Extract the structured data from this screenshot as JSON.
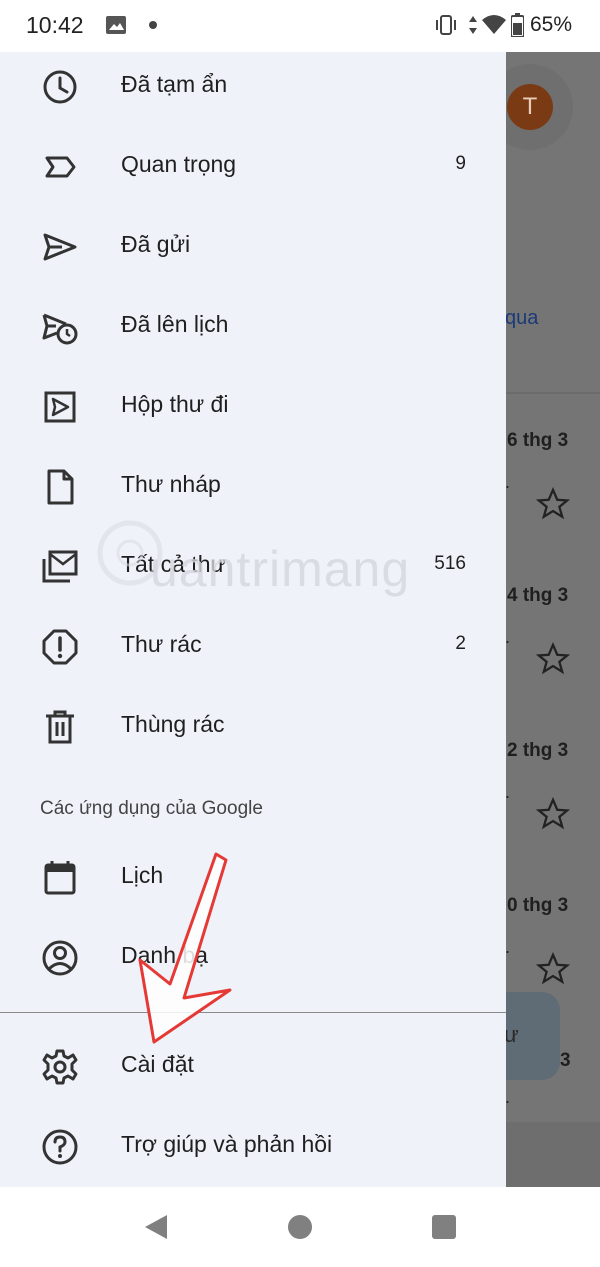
{
  "status_bar": {
    "time": "10:42",
    "battery": "65%",
    "icons": [
      "image-icon",
      "dot-icon",
      "vibrate-icon",
      "data-icon",
      "wifi-icon",
      "battery-icon"
    ]
  },
  "drawer": {
    "items": [
      {
        "label": "Đã tạm ẩn",
        "count": "",
        "icon": "clock-icon"
      },
      {
        "label": "Quan trọng",
        "count": "9",
        "icon": "label-important-icon"
      },
      {
        "label": "Đã gửi",
        "count": "",
        "icon": "send-icon"
      },
      {
        "label": "Đã lên lịch",
        "count": "",
        "icon": "scheduled-send-icon"
      },
      {
        "label": "Hộp thư đi",
        "count": "",
        "icon": "outbox-icon"
      },
      {
        "label": "Thư nháp",
        "count": "",
        "icon": "draft-icon"
      },
      {
        "label": "Tất cả thư",
        "count": "516",
        "icon": "all-mail-icon"
      },
      {
        "label": "Thư rác",
        "count": "2",
        "icon": "spam-icon"
      },
      {
        "label": "Thùng rác",
        "count": "",
        "icon": "trash-icon"
      }
    ],
    "google_apps_label": "Các ứng dụng của Google",
    "apps": [
      {
        "label": "Lịch",
        "icon": "calendar-icon"
      },
      {
        "label": "Danh bạ",
        "icon": "contacts-icon"
      }
    ],
    "footer": [
      {
        "label": "Cài đặt",
        "icon": "settings-icon"
      },
      {
        "label": "Trợ giúp và phản hồi",
        "icon": "help-icon"
      }
    ]
  },
  "background": {
    "avatar_letter": "T",
    "link_fragment": "qua",
    "dates": [
      "6 thg 3",
      "4 thg 3",
      "2 thg 3",
      "0 thg 3",
      "3"
    ],
    "fab_fragment": "ư"
  },
  "watermark": "uantrimang",
  "colors": {
    "drawer_bg": "#eff2f9",
    "scrim": "#757575",
    "annotation_arrow": "#e53935",
    "avatar": "#7a3a14"
  }
}
